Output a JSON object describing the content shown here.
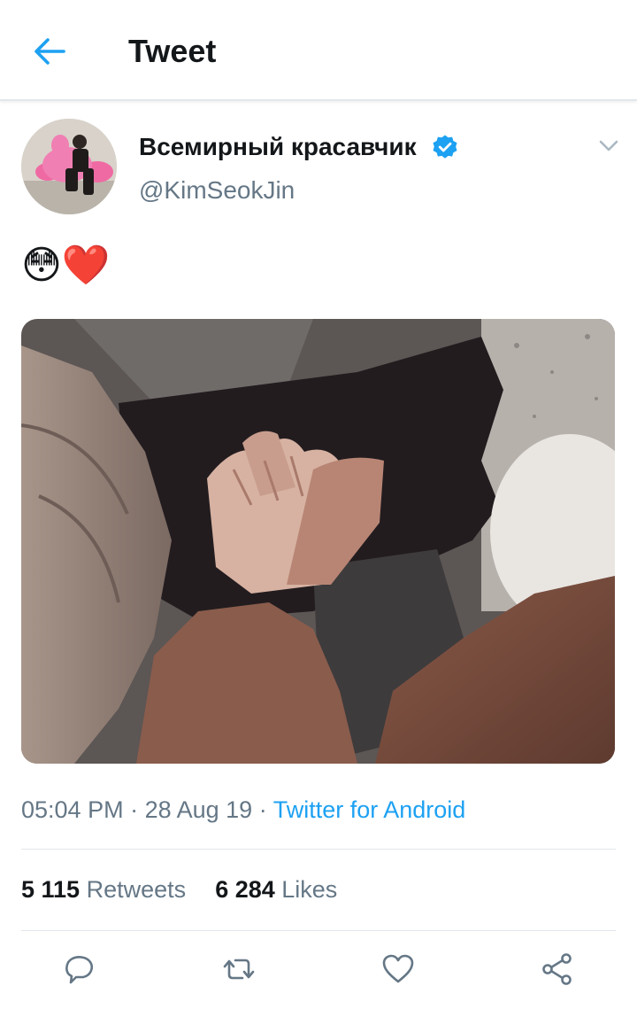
{
  "header": {
    "title": "Tweet",
    "back_icon": "back-arrow-icon"
  },
  "tweet": {
    "author_name": "Всемирный красавчик",
    "author_handle": "@KimSeokJin",
    "verified": true,
    "text": "😳❤️",
    "time": "05:04 PM",
    "date": "28 Aug 19",
    "source": "Twitter for Android",
    "retweets": {
      "count": "5 115",
      "label": "Retweets"
    },
    "likes": {
      "count": "6 284",
      "label": "Likes"
    }
  },
  "actions": [
    "reply-icon",
    "retweet-icon",
    "like-icon",
    "share-icon"
  ],
  "colors": {
    "accent": "#1da1f2",
    "text_primary": "#14171a",
    "text_secondary": "#657786",
    "divider": "#e1e8ed"
  }
}
